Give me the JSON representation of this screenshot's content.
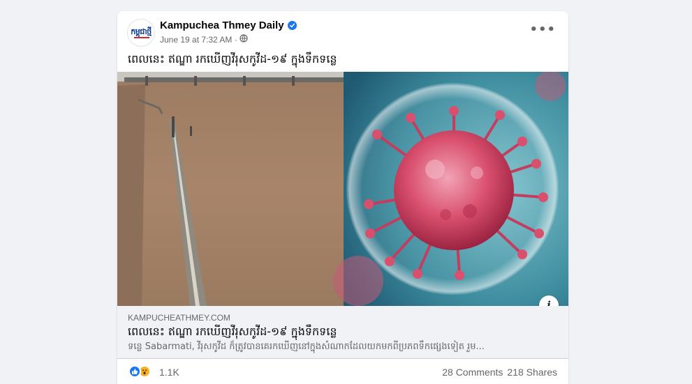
{
  "post": {
    "page_name": "Kampuchea Thmey Daily",
    "avatar_text": "កម្ពុជាថ្មី",
    "timestamp": "June 19 at 7:32 AM ·",
    "body_text": "ពេលនេះ ឥណ្ឌា រកឃើញវីរុសកូវីដ-១៩ ក្នុងទឹកទន្លេ"
  },
  "link": {
    "domain": "KAMPUCHEATHMEY.COM",
    "title": "ពេលនេះ ឥណ្ឌា រកឃើញវីរុសកូវីដ-១៩ ក្នុងទឹកទន្លេ",
    "description": "ទន្លេ Sabarmati, វីរុសកូវីដ ក៏ត្រូវបានគេរកឃើញនៅក្នុងសំណាកដែលយកមកពីប្រភពទឹកផ្សេងទៀត រួម..."
  },
  "stats": {
    "reaction_count": "1.1K",
    "comments": "28 Comments",
    "shares": "218 Shares"
  },
  "icons": {
    "verified": "verified-badge-icon",
    "privacy": "globe-icon",
    "more": "more-options-icon",
    "info": "info-icon",
    "like": "like-reaction-icon",
    "wow": "wow-reaction-icon"
  },
  "colors": {
    "accent": "#1877f2",
    "page_bg": "#f0f2f5",
    "secondary_text": "#65676b",
    "wow": "#f7b125"
  }
}
